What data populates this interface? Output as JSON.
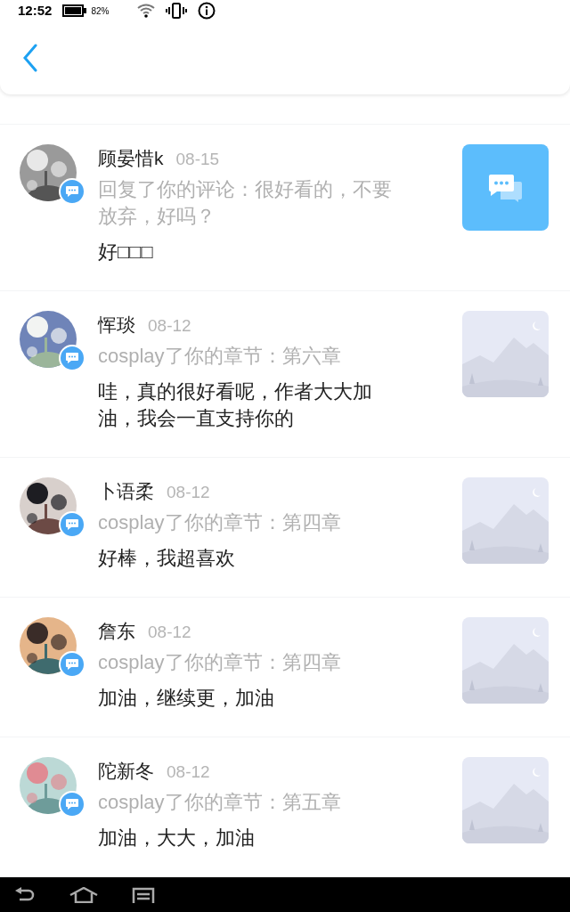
{
  "status_bar": {
    "time": "12:52",
    "battery_percent": "82%"
  },
  "items": [
    {
      "name": "顾晏惜k",
      "date": "08-15",
      "action": "回复了你的评论：很好看的，不要放弃，好吗？",
      "message": "好□□□",
      "kind": "comment"
    },
    {
      "name": "恽琰",
      "date": "08-12",
      "action": "cosplay了你的章节：第六章",
      "message": "哇，真的很好看呢，作者大大加油，我会一直支持你的",
      "kind": "placeholder"
    },
    {
      "name": "卜语柔",
      "date": "08-12",
      "action": "cosplay了你的章节：第四章",
      "message": "好棒，我超喜欢",
      "kind": "placeholder"
    },
    {
      "name": "詹东",
      "date": "08-12",
      "action": "cosplay了你的章节：第四章",
      "message": "加油，继续更，加油",
      "kind": "placeholder"
    },
    {
      "name": "陀新冬",
      "date": "08-12",
      "action": "cosplay了你的章节：第五章",
      "message": "加油，大大，加油",
      "kind": "placeholder"
    }
  ]
}
